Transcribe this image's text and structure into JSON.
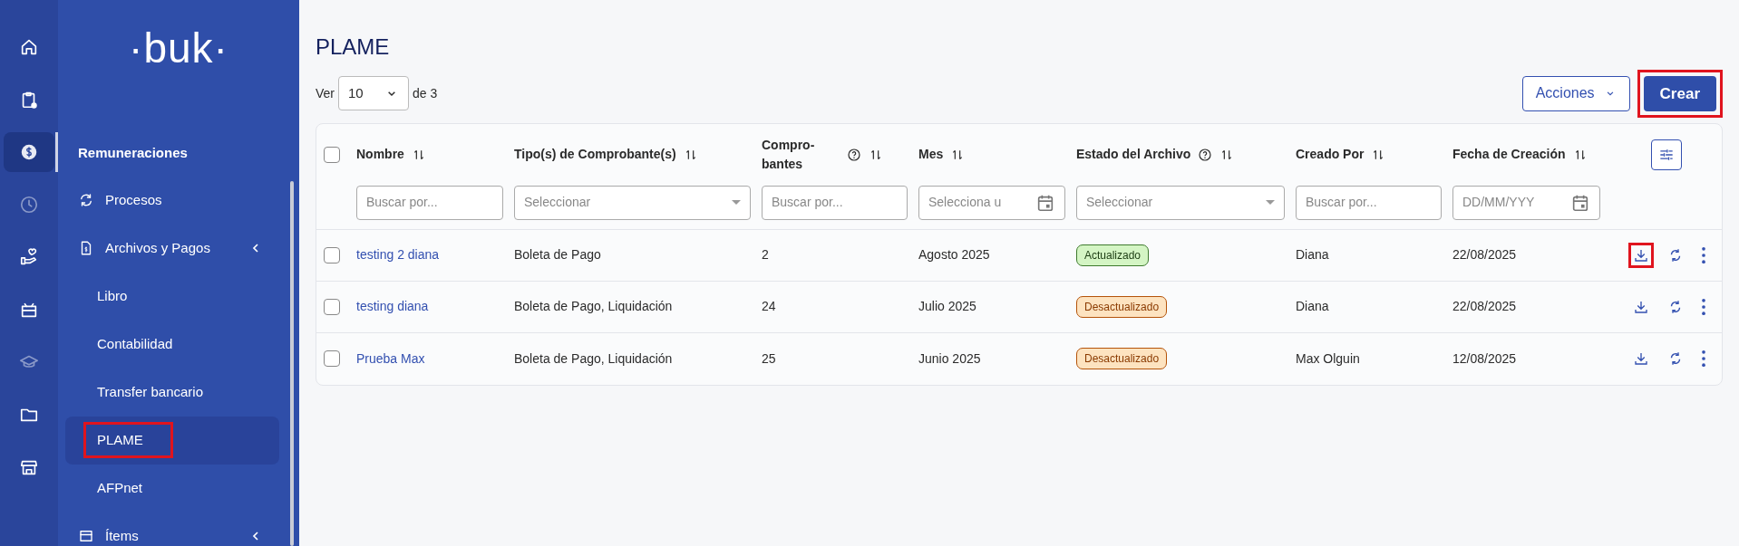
{
  "rail": [
    {
      "selected": false,
      "disabled": false
    },
    {
      "selected": false,
      "disabled": false
    },
    {
      "selected": true,
      "disabled": false
    },
    {
      "selected": false,
      "disabled": true
    },
    {
      "selected": false,
      "disabled": false
    },
    {
      "selected": false,
      "disabled": false
    },
    {
      "selected": false,
      "disabled": true
    },
    {
      "selected": false,
      "disabled": false
    },
    {
      "selected": false,
      "disabled": false
    }
  ],
  "logo": "·buk·",
  "sidebar": {
    "section": "Remuneraciones",
    "items": [
      {
        "label": "Procesos",
        "kind": "link"
      },
      {
        "label": "Archivos y Pagos",
        "kind": "group",
        "children": [
          {
            "label": "Libro",
            "selected": false,
            "highlighted": false
          },
          {
            "label": "Contabilidad",
            "selected": false,
            "highlighted": false
          },
          {
            "label": "Transfer bancario",
            "selected": false,
            "highlighted": false
          },
          {
            "label": "PLAME",
            "selected": true,
            "highlighted": true
          },
          {
            "label": "AFPnet",
            "selected": false,
            "highlighted": false
          }
        ]
      },
      {
        "label": "Ítems",
        "kind": "group"
      }
    ]
  },
  "page_title": "PLAME",
  "per_page": {
    "prefix": "Ver",
    "value": "10",
    "suffix": "de 3"
  },
  "actions": [
    {
      "label": "Acciones",
      "kind": "dropdown",
      "highlighted": false
    },
    {
      "label": "Crear",
      "kind": "primary",
      "highlighted": true
    }
  ],
  "table": {
    "select_all": {
      "checked": false
    },
    "columns": [
      {
        "label": "Nombre",
        "help": false,
        "filter": {
          "kind": "text",
          "placeholder": "Buscar por..."
        }
      },
      {
        "label": "Tipo(s) de Comprobante(s)",
        "help": false,
        "filter": {
          "kind": "select",
          "placeholder": "Seleccionar"
        }
      },
      {
        "label": "Compro-bantes",
        "help": true,
        "filter": {
          "kind": "text",
          "placeholder": "Buscar por..."
        }
      },
      {
        "label": "Mes",
        "help": false,
        "filter": {
          "kind": "date",
          "placeholder": "Selecciona u"
        }
      },
      {
        "label": "Estado del Archivo",
        "help": true,
        "filter": {
          "kind": "select",
          "placeholder": "Seleccionar"
        }
      },
      {
        "label": "Creado Por",
        "help": false,
        "filter": {
          "kind": "text",
          "placeholder": "Buscar por..."
        }
      },
      {
        "label": "Fecha de Creación",
        "help": false,
        "filter": {
          "kind": "date",
          "placeholder": "DD/MM/YYY"
        }
      }
    ],
    "rows": [
      {
        "checked": false,
        "name": "testing 2 diana",
        "types": "Boleta de Pago",
        "count": "2",
        "month": "Agosto 2025",
        "status": {
          "label": "Actualizado",
          "kind": "ok"
        },
        "created_by": "Diana",
        "created_at": "22/08/2025",
        "download_highlighted": true
      },
      {
        "checked": false,
        "name": "testing diana",
        "types": "Boleta de Pago, Liquidación",
        "count": "24",
        "month": "Julio 2025",
        "status": {
          "label": "Desactualizado",
          "kind": "warn"
        },
        "created_by": "Diana",
        "created_at": "22/08/2025",
        "download_highlighted": false
      },
      {
        "checked": false,
        "name": "Prueba Max",
        "types": "Boleta de Pago, Liquidación",
        "count": "25",
        "month": "Junio 2025",
        "status": {
          "label": "Desactualizado",
          "kind": "warn"
        },
        "created_by": "Max Olguin",
        "created_at": "12/08/2025",
        "download_highlighted": false
      }
    ]
  }
}
